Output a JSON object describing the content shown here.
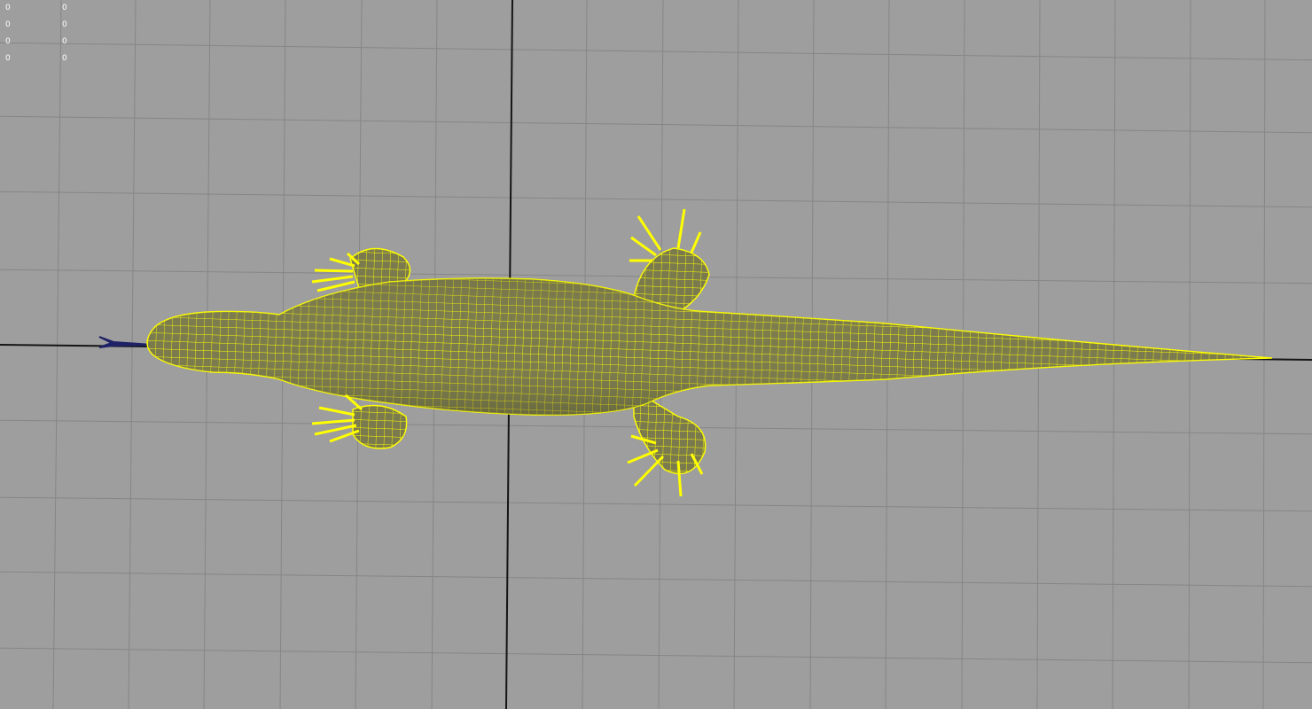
{
  "viewport": {
    "view": "top",
    "grid": true,
    "background_color": "#9e9e9e",
    "grid_color": "#858585",
    "axis_color": "#111111",
    "wireframe_color": "#ffff00",
    "shaded_color": "#7c7c52",
    "selected_object": "lizard-mesh",
    "tongue_color": "#1e2266"
  },
  "hud": {
    "stats": [
      {
        "value_a": "0",
        "value_b": "0"
      },
      {
        "value_a": "0",
        "value_b": "0"
      },
      {
        "value_a": "0",
        "value_b": "0"
      },
      {
        "value_a": "0",
        "value_b": "0"
      }
    ]
  }
}
